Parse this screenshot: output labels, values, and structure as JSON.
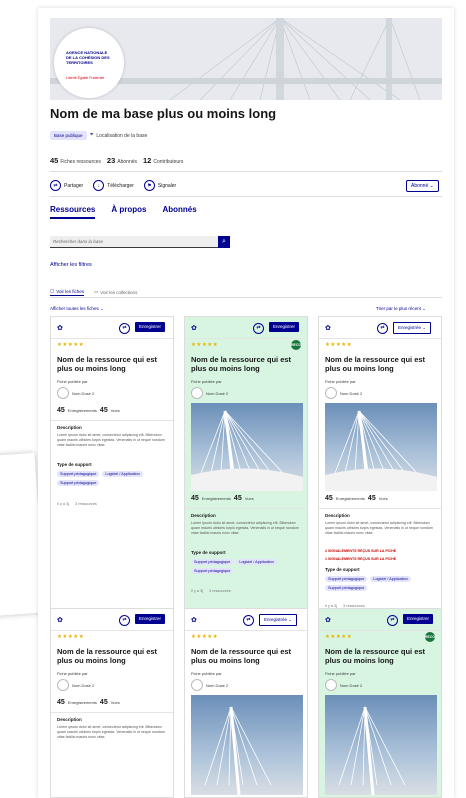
{
  "banner": {
    "logo_title": "AGENCE NATIONALE DE LA COHÉSION DES TERRITOIRES",
    "logo_subtitle": "Liberté Égalité Fraternité"
  },
  "base": {
    "title": "Nom de ma base plus ou moins long",
    "badge": "Base publique",
    "location": "Localisation de la base",
    "stats": [
      {
        "value": "45",
        "label": "Fiches ressources"
      },
      {
        "value": "23",
        "label": "Abonnés"
      },
      {
        "value": "12",
        "label": "Contributeurs"
      }
    ]
  },
  "actions": {
    "share": "Partager",
    "download": "Télécharger",
    "report": "Signaler",
    "follow": "Abonné"
  },
  "tabs": [
    "Ressources",
    "À propos",
    "Abonnés"
  ],
  "search": {
    "placeholder": "Rechercher dans la base"
  },
  "filters_label": "Afficher les filtres",
  "segments": {
    "sheets": "Voir les fiches",
    "collections": "Voir les collections"
  },
  "show_all": "Afficher toutes les fiches",
  "sort": "Trier par le plus récent",
  "card_common": {
    "title": "Nom de la ressource qui est plus ou moins long",
    "published_by": "Fiche publiée par",
    "author": "Nom Dosé 2",
    "downloads_value": "45",
    "downloads_label": "Enregistrements",
    "views_value": "45",
    "views_label": "Vues",
    "desc_heading": "Description",
    "description": "Lorem ipsum dolor sit amet, consectetur adipiscing elit. Bibendum quam mauris ultricies turpis egestas. Venenatis in ut neque nondum vitae facilisi mauris nunc vitae.",
    "support_heading": "Type de support",
    "tags": [
      "Support pédagogique",
      "Logiciel / Application",
      "Support pédagogique"
    ],
    "footer_a": "Il y a 3j",
    "footer_b": "3 ressources",
    "rec": "RECO",
    "save": "Enregistrer",
    "saved": "Enregistrée",
    "warn_1": "2 SIGNALEMENTS REÇUS SUR LA FICHE",
    "warn_2": "1 SIGNALEMENTS REÇUS SUR LA FICHE",
    "stars": "★★★★★"
  },
  "colors": {
    "primary": "#000091",
    "green": "#d8f5e2",
    "tag": "#e3e3fd",
    "star": "#e9b500",
    "warn": "#ce0500"
  }
}
